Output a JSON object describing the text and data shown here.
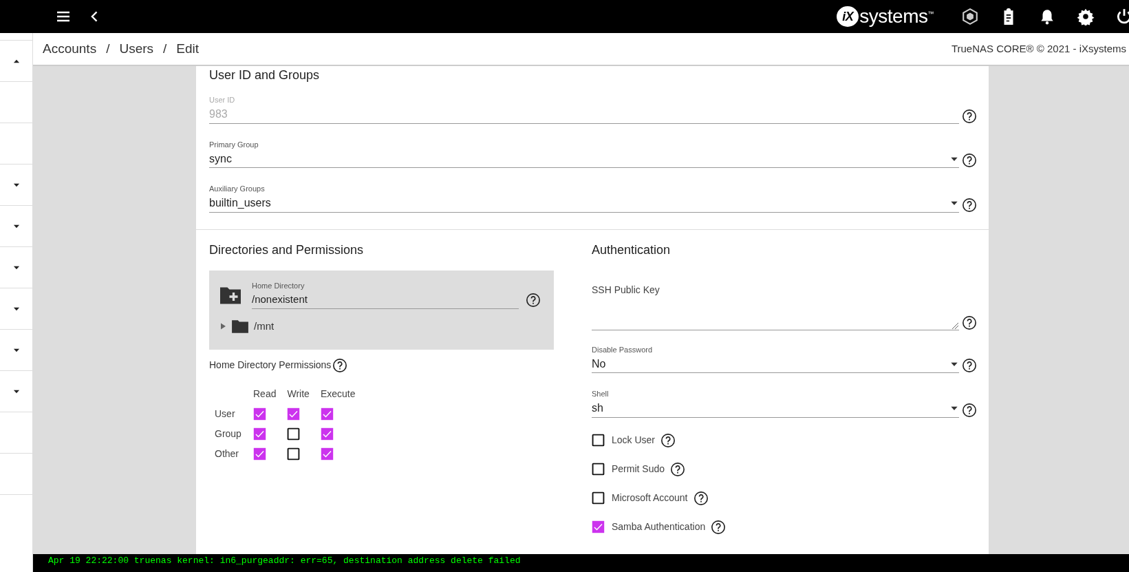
{
  "topbar": {
    "brand_mark": "iX",
    "brand_word": "systems",
    "brand_tm": "™"
  },
  "breadcrumb": {
    "items": [
      "Accounts",
      "Users",
      "Edit"
    ],
    "separator": "/",
    "copyright": "TrueNAS CORE® © 2021 - iXsystems"
  },
  "sidebar": {
    "items": [
      {
        "kind": "toggle",
        "expanded": true
      },
      {
        "kind": "plain"
      },
      {
        "kind": "plain"
      },
      {
        "kind": "toggle",
        "expanded": false
      },
      {
        "kind": "toggle",
        "expanded": false
      },
      {
        "kind": "toggle",
        "expanded": false
      },
      {
        "kind": "toggle",
        "expanded": false
      },
      {
        "kind": "toggle",
        "expanded": false
      },
      {
        "kind": "toggle",
        "expanded": false
      },
      {
        "kind": "plain"
      },
      {
        "kind": "plain"
      },
      {
        "kind": "plain"
      }
    ]
  },
  "user_id_and_groups": {
    "title": "User ID and Groups",
    "fields": [
      {
        "kind": "text",
        "label": "User ID",
        "value": "983",
        "disabled": true
      },
      {
        "kind": "select",
        "label": "Primary Group",
        "value": "sync",
        "disabled": false
      },
      {
        "kind": "select",
        "label": "Auxiliary Groups",
        "value": "builtin_users",
        "disabled": false
      }
    ]
  },
  "directories": {
    "title": "Directories and Permissions",
    "home_directory": {
      "label": "Home Directory",
      "value": "/nonexistent",
      "tree": [
        {
          "name": "/mnt",
          "expanded": false
        }
      ]
    },
    "permissions": {
      "title": "Home Directory Permissions",
      "columns": [
        "Read",
        "Write",
        "Execute"
      ],
      "rows": [
        {
          "label": "User",
          "cells": [
            {
              "checked": true
            },
            {
              "checked": true
            },
            {
              "checked": true
            }
          ]
        },
        {
          "label": "Group",
          "cells": [
            {
              "checked": true
            },
            {
              "checked": false
            },
            {
              "checked": true
            }
          ]
        },
        {
          "label": "Other",
          "cells": [
            {
              "checked": true
            },
            {
              "checked": false
            },
            {
              "checked": true
            }
          ]
        }
      ]
    }
  },
  "authentication": {
    "title": "Authentication",
    "ssh_key": {
      "label": "SSH Public Key"
    },
    "fields": [
      {
        "kind": "select",
        "label": "Disable Password",
        "value": "No",
        "disabled": false
      },
      {
        "kind": "select",
        "label": "Shell",
        "value": "sh",
        "disabled": false
      }
    ],
    "checkboxes": [
      {
        "label": "Lock User",
        "checked": false
      },
      {
        "label": "Permit Sudo",
        "checked": false
      },
      {
        "label": "Microsoft Account",
        "checked": false
      },
      {
        "label": "Samba Authentication",
        "checked": true
      }
    ]
  },
  "console": {
    "lines": [
      "Apr 19 22:22:00 truenas kernel: in6_purgeaddr: err=65, destination address delete failed"
    ]
  }
}
